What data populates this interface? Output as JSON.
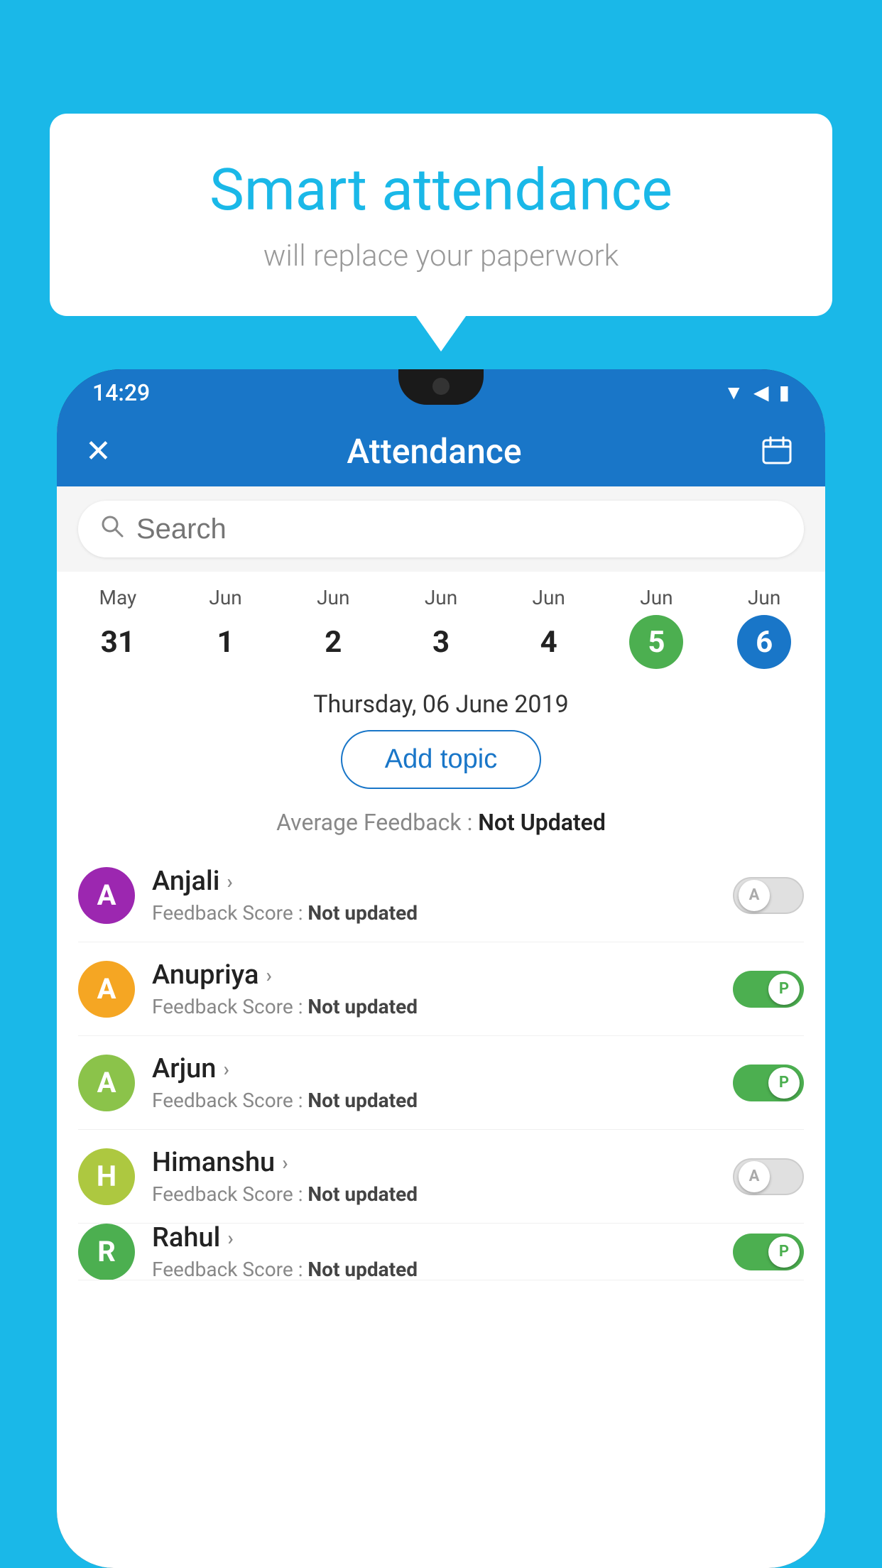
{
  "background_color": "#1ab8e8",
  "bubble": {
    "title": "Smart attendance",
    "subtitle": "will replace your paperwork"
  },
  "status_bar": {
    "time": "14:29",
    "icons": [
      "wifi",
      "signal",
      "battery"
    ]
  },
  "app_bar": {
    "title": "Attendance",
    "close_icon": "✕",
    "calendar_icon": "📅"
  },
  "search": {
    "placeholder": "Search"
  },
  "calendar": {
    "dates": [
      {
        "month": "May",
        "day": "31",
        "state": "normal"
      },
      {
        "month": "Jun",
        "day": "1",
        "state": "normal"
      },
      {
        "month": "Jun",
        "day": "2",
        "state": "normal"
      },
      {
        "month": "Jun",
        "day": "3",
        "state": "normal"
      },
      {
        "month": "Jun",
        "day": "4",
        "state": "normal"
      },
      {
        "month": "Jun",
        "day": "5",
        "state": "today"
      },
      {
        "month": "Jun",
        "day": "6",
        "state": "selected"
      }
    ],
    "selected_date_label": "Thursday, 06 June 2019"
  },
  "add_topic_label": "Add topic",
  "avg_feedback": {
    "label": "Average Feedback : ",
    "value": "Not Updated"
  },
  "students": [
    {
      "name": "Anjali",
      "initial": "A",
      "avatar_color": "#9c27b0",
      "feedback_label": "Feedback Score : ",
      "feedback_value": "Not updated",
      "toggle": "off"
    },
    {
      "name": "Anupriya",
      "initial": "A",
      "avatar_color": "#f5a623",
      "feedback_label": "Feedback Score : ",
      "feedback_value": "Not updated",
      "toggle": "on"
    },
    {
      "name": "Arjun",
      "initial": "A",
      "avatar_color": "#8bc34a",
      "feedback_label": "Feedback Score : ",
      "feedback_value": "Not updated",
      "toggle": "on"
    },
    {
      "name": "Himanshu",
      "initial": "H",
      "avatar_color": "#adc840",
      "feedback_label": "Feedback Score : ",
      "feedback_value": "Not updated",
      "toggle": "off"
    },
    {
      "name": "Rahul",
      "initial": "R",
      "avatar_color": "#4caf50",
      "feedback_label": "Feedback Score : ",
      "feedback_value": "Not updated",
      "toggle": "on"
    }
  ],
  "toggle_labels": {
    "off": "A",
    "on": "P"
  }
}
